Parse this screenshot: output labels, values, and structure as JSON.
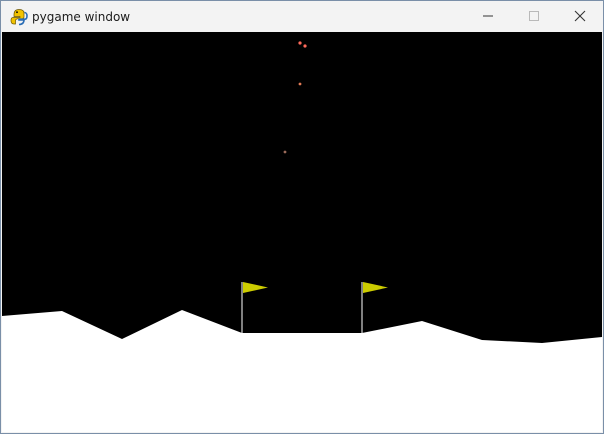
{
  "window": {
    "title": "pygame window",
    "app_icon": "pygame-snake-icon",
    "controls": {
      "minimize_icon": "minimize-icon",
      "maximize_icon": "maximize-icon",
      "close_icon": "close-icon"
    }
  },
  "game": {
    "background_color": "#000000",
    "terrain_color": "#ffffff",
    "flag_color": "#cccc00",
    "flag_pole_color": "#ffffff",
    "particle_color": "#ff6a5a"
  }
}
